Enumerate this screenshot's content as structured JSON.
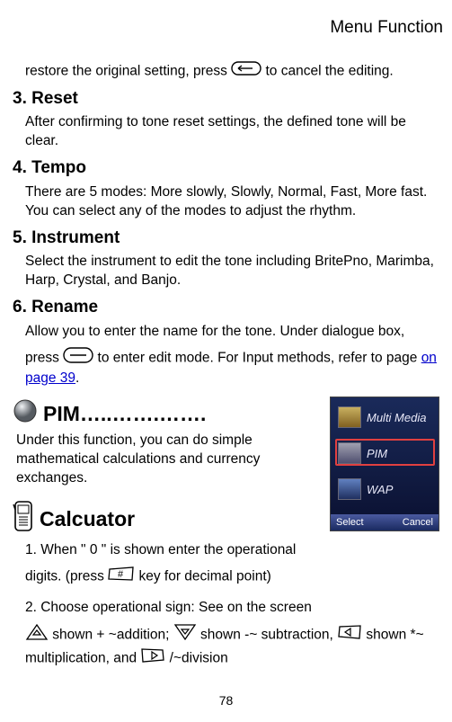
{
  "header": {
    "title": "Menu Function"
  },
  "intro": {
    "restore_pre": "restore the original setting, press",
    "restore_post": " to cancel the editing."
  },
  "sections": {
    "reset": {
      "title": "3. Reset",
      "body": "After confirming to tone reset settings, the defined tone will be clear."
    },
    "tempo": {
      "title": "4. Tempo",
      "body": "There are 5 modes: More slowly, Slowly, Normal, Fast, More fast. You can select any of the modes to adjust the rhythm."
    },
    "instrument": {
      "title": "5. Instrument",
      "body": "Select the instrument to edit the tone including BritePno, Marimba, Harp, Crystal, and Banjo."
    },
    "rename": {
      "title": "6. Rename",
      "p1a": "Allow you to enter the name for the tone.    Under dialogue box,",
      "p2a": "press ",
      "p2b": " to enter edit mode.    For Input methods, refer to page ",
      "link": "on page 39",
      "p2c": "."
    }
  },
  "pim": {
    "title": "PIM…..…….…….",
    "body": "Under this function, you can do simple mathematical calculations and currency exchanges."
  },
  "calc": {
    "title": "Calcuator",
    "l1a": "1. When \" 0 \" is shown enter the operational",
    "l1b": "digits. (press ",
    "l1c": " key for decimal point)",
    "l2": "2. Choose operational sign: See on the screen",
    "op_add": " shown + ~addition; ",
    "op_sub": " shown -~ subtraction, ",
    "op_mul": " shown *~ multiplication, and ",
    "op_div": " /~division"
  },
  "phone": {
    "row1": "Multi Media",
    "row2": "PIM",
    "row3": "WAP",
    "soft_left": "Select",
    "soft_right": "Cancel"
  },
  "page_number": "78"
}
